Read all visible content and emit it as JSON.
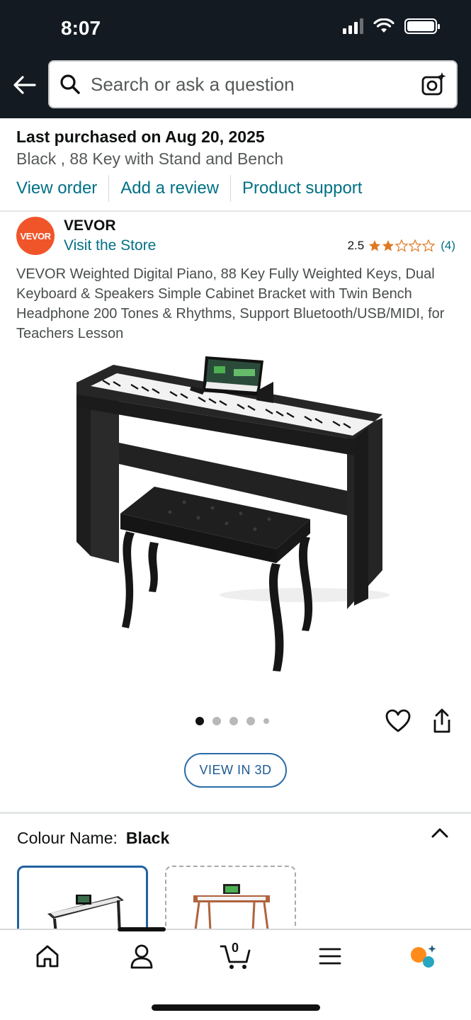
{
  "status_bar": {
    "time": "8:07"
  },
  "header": {
    "search_placeholder": "Search or ask a question"
  },
  "purchase": {
    "title": "Last purchased on Aug 20, 2025",
    "variant": "Black , 88 Key with Stand and Bench",
    "links": [
      "View order",
      "Add a review",
      "Product support"
    ]
  },
  "brand": {
    "logo_text": "VEVOR",
    "name": "VEVOR",
    "store_link": "Visit the Store",
    "rating": "2.5",
    "rating_value": 2.5,
    "rating_count": "(4)"
  },
  "product": {
    "title": "VEVOR Weighted Digital Piano, 88 Key Fully Weighted Keys, Dual Keyboard & Speakers Simple Cabinet Bracket with Twin Bench Headphone 200 Tones & Rhythms, Support Bluetooth/USB/MIDI, for Teachers Lesson",
    "view_3d_label": "VIEW IN 3D",
    "carousel": {
      "count": 5,
      "active_index": 0
    }
  },
  "colour": {
    "label": "Colour Name:",
    "selected": "Black",
    "options": [
      "Black",
      "Brown"
    ]
  },
  "bottom_nav": {
    "items": [
      "home-icon",
      "account-icon",
      "cart-icon",
      "menu-icon",
      "rufus-icon"
    ],
    "cart_count": "0"
  },
  "colors": {
    "header_bg": "#131a22",
    "link": "#007185",
    "star": "#de7921",
    "brand_logo": "#f0552a"
  }
}
